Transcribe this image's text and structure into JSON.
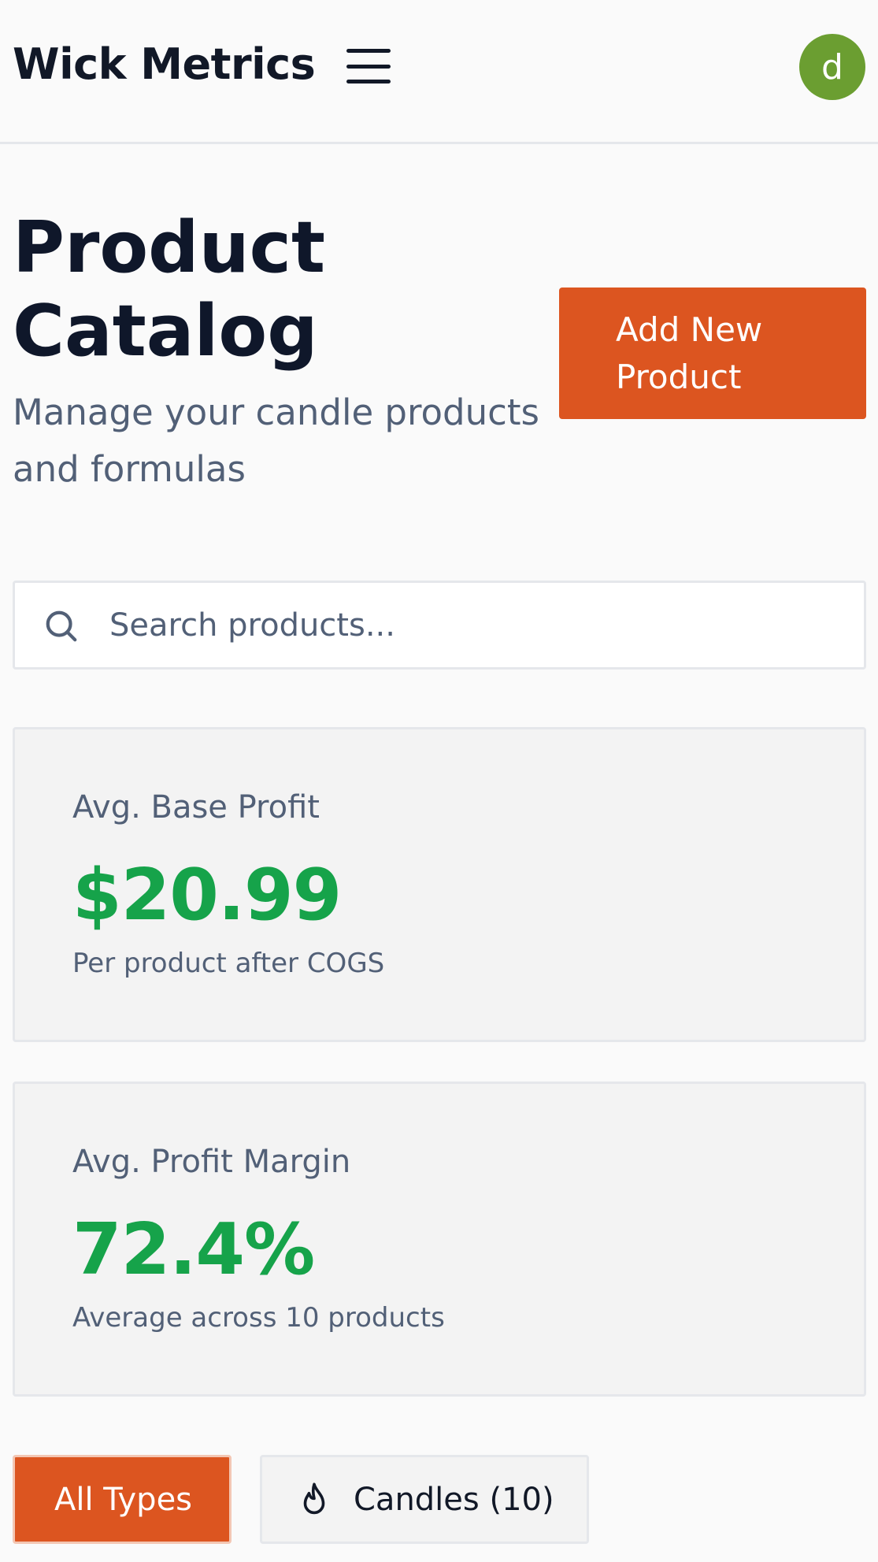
{
  "header": {
    "brand": "Wick Metrics",
    "avatar_initial": "d"
  },
  "page": {
    "title": "Product Catalog",
    "subtitle": "Manage your candle products and formulas",
    "add_button_label": "Add New Product"
  },
  "search": {
    "placeholder": "Search products...",
    "value": ""
  },
  "stats": [
    {
      "label": "Avg. Base Profit",
      "value": "$20.99",
      "note": "Per product after COGS"
    },
    {
      "label": "Avg. Profit Margin",
      "value": "72.4%",
      "note": "Average across 10 products"
    }
  ],
  "filters": [
    {
      "label": "All Types",
      "active": true
    },
    {
      "label": "Candles (10)",
      "active": false,
      "icon": "flame-icon"
    }
  ],
  "colors": {
    "accent": "#dc5520",
    "positive": "#16a34a",
    "avatar": "#6b9e31",
    "muted_text": "#526077"
  }
}
